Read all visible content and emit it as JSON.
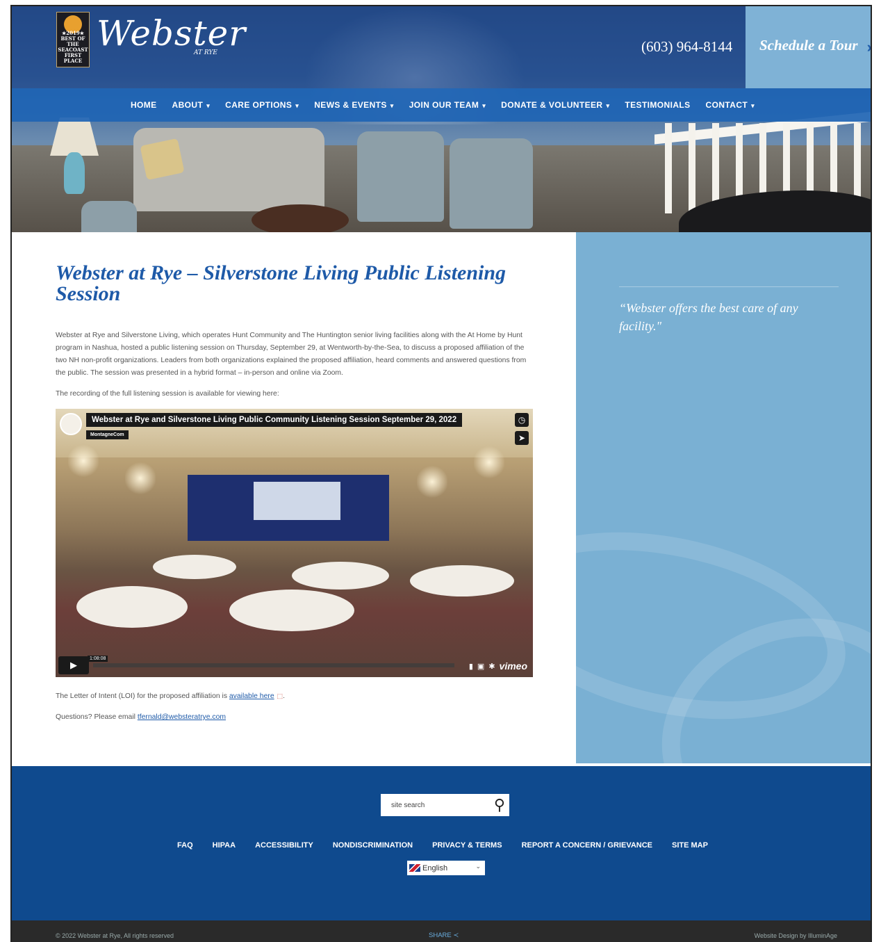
{
  "header": {
    "badge_lines": [
      "★2019★",
      "BEST OF THE",
      "SEACOAST",
      "FIRST PLACE"
    ],
    "logo_text": "Webster",
    "logo_subtext": "AT RYE",
    "phone": "(603) 964-8144",
    "cta_label": "Schedule a Tour",
    "cta_icon": "chevron-right-icon"
  },
  "nav": {
    "items": [
      {
        "label": "HOME",
        "has_dropdown": false
      },
      {
        "label": "ABOUT",
        "has_dropdown": true
      },
      {
        "label": "CARE OPTIONS",
        "has_dropdown": true
      },
      {
        "label": "NEWS & EVENTS",
        "has_dropdown": true
      },
      {
        "label": "JOIN OUR TEAM",
        "has_dropdown": true
      },
      {
        "label": "DONATE & VOLUNTEER",
        "has_dropdown": true
      },
      {
        "label": "TESTIMONIALS",
        "has_dropdown": false
      },
      {
        "label": "CONTACT",
        "has_dropdown": true
      }
    ]
  },
  "main": {
    "title": "Webster at Rye – Silverstone Living Public Listening Session",
    "paragraph1": "Webster at Rye and Silverstone Living, which operates Hunt Community and The Huntington senior living facilities along with the At Home by Hunt program in Nashua, hosted a public listening session on Thursday, September 29, at Wentworth-by-the-Sea, to discuss a proposed affiliation of the two NH non-profit organizations. Leaders from both organizations explained the proposed affiliation, heard comments and answered questions from the public. The session was presented in a hybrid format – in-person and online via Zoom.",
    "paragraph2": "The recording of the full listening session is available for viewing here:",
    "video": {
      "title": "Webster at Rye and Silverstone Living Public Community Listening Session September 29, 2022",
      "channel": "MontagneCom",
      "duration": "1:08:08",
      "brand": "vimeo"
    },
    "loi_prefix": "The Letter of Intent (LOI) for the proposed affiliation is ",
    "loi_link": "available here",
    "loi_suffix": ".",
    "questions_prefix": "Questions? Please email ",
    "email": "tfernald@websteratrye.com"
  },
  "sidebar": {
    "quote": "“Webster offers the best care of any facility.\""
  },
  "footer": {
    "search_placeholder": "site search",
    "links": [
      "FAQ",
      "HIPAA",
      "ACCESSIBILITY",
      "NONDISCRIMINATION",
      "PRIVACY & TERMS",
      "REPORT A CONCERN / GRIEVANCE",
      "SITE MAP"
    ],
    "language": "English",
    "copyright": "© 2022 Webster at Rye, All rights reserved",
    "share": "SHARE",
    "credit": "Website Design by IlluminAge"
  },
  "colors": {
    "brand_blue": "#1e5aa8",
    "footer_blue": "#0f4a8e",
    "sidebar_blue": "#7ab0d3",
    "cta_blue": "#7fb2d6"
  }
}
